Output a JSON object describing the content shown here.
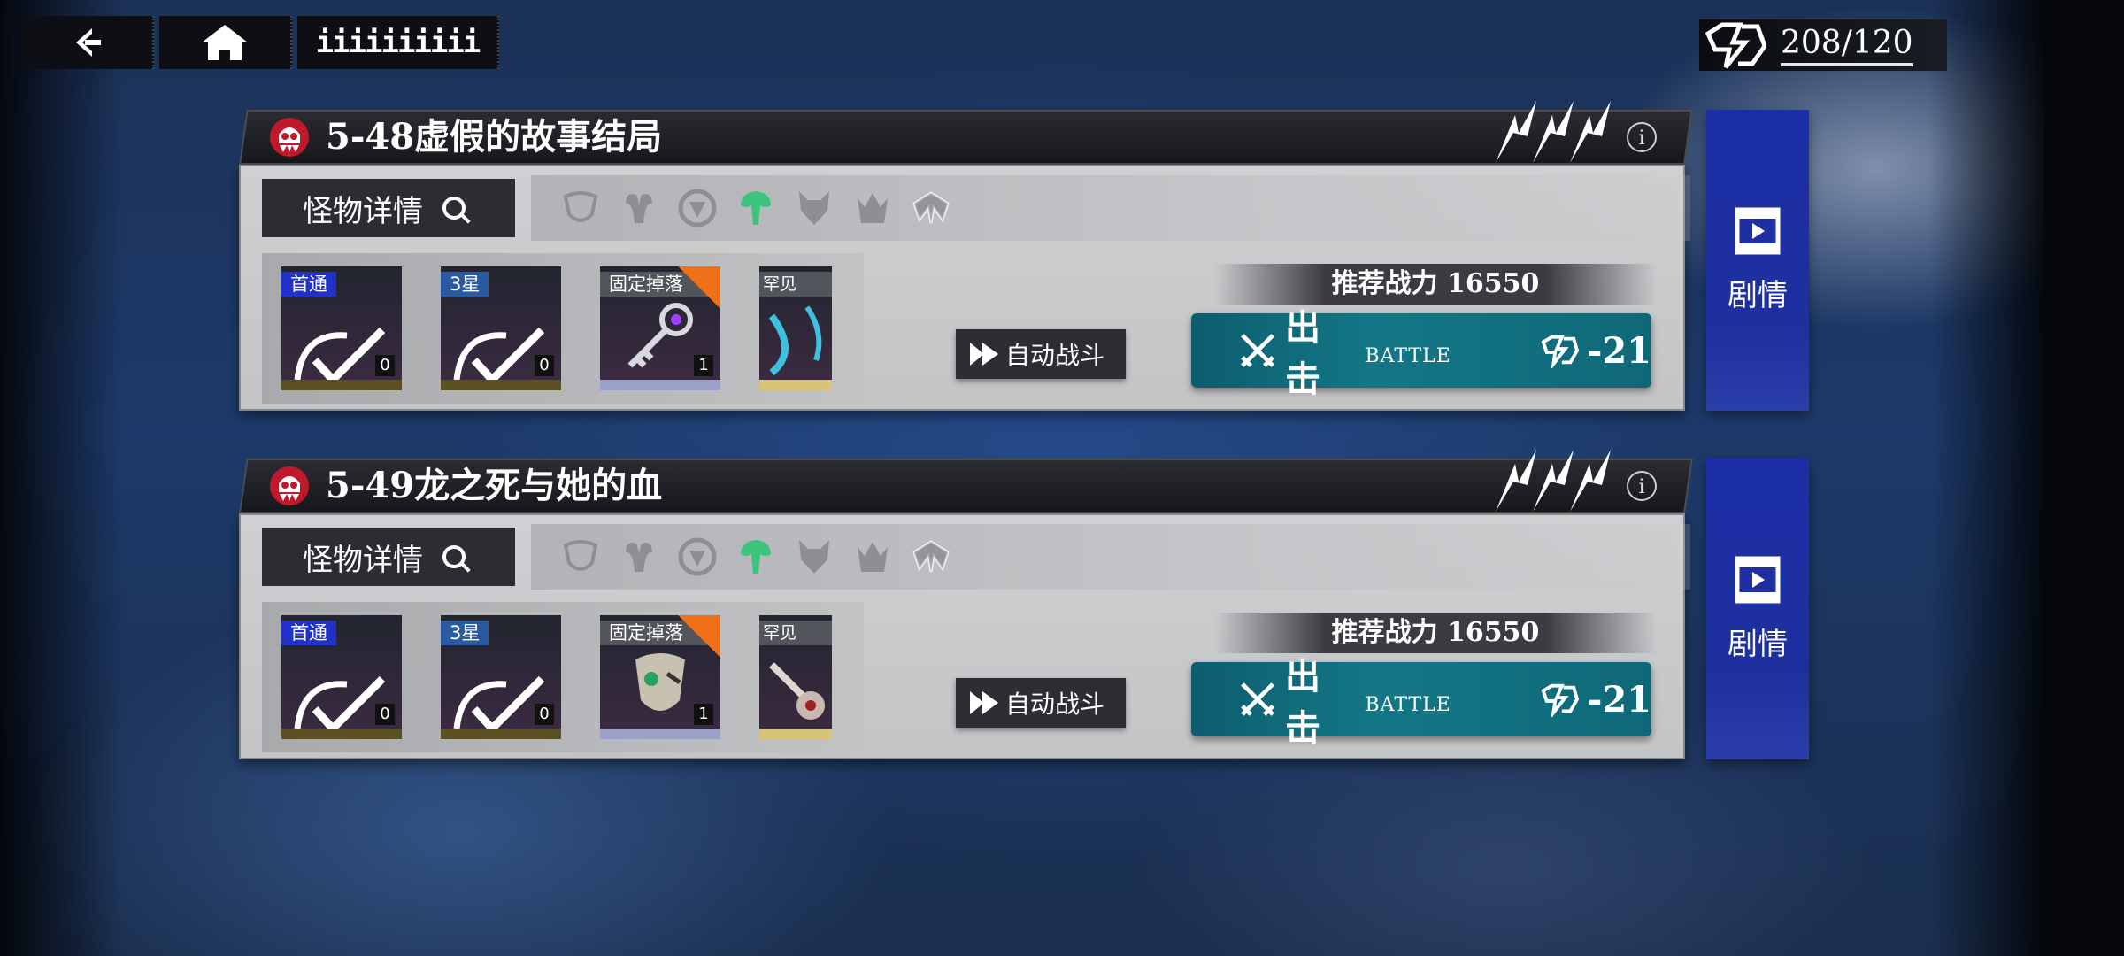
{
  "nav": {
    "menu_label": "iiiiiiiiii"
  },
  "stamina": {
    "value": "208/120"
  },
  "stages": [
    {
      "title": "5-48虚假的故事结局",
      "monster_button": "怪物详情",
      "rewards": [
        {
          "tag": "首通",
          "qty": "0"
        },
        {
          "tag": "3星",
          "qty": "0"
        },
        {
          "tag": "固定掉落",
          "qty": "1"
        },
        {
          "tag": "罕见"
        }
      ],
      "auto_battle": "自动战斗",
      "recommended_power": "推荐战力 16550",
      "battle_label": "出击",
      "battle_sub": "BATTLE",
      "battle_cost": "-21",
      "story_label": "剧情"
    },
    {
      "title": "5-49龙之死与她的血",
      "monster_button": "怪物详情",
      "rewards": [
        {
          "tag": "首通",
          "qty": "0"
        },
        {
          "tag": "3星",
          "qty": "0"
        },
        {
          "tag": "固定掉落",
          "qty": "1"
        },
        {
          "tag": "罕见"
        }
      ],
      "auto_battle": "自动战斗",
      "recommended_power": "推荐战力 16550",
      "battle_label": "出击",
      "battle_sub": "BATTLE",
      "battle_cost": "-21",
      "story_label": "剧情"
    }
  ],
  "colors": {
    "battle_teal": "#137786",
    "story_blue": "#1e2f9e",
    "first_clear_tag": "#2231c8",
    "highlight_trait": "#3cc47c"
  }
}
